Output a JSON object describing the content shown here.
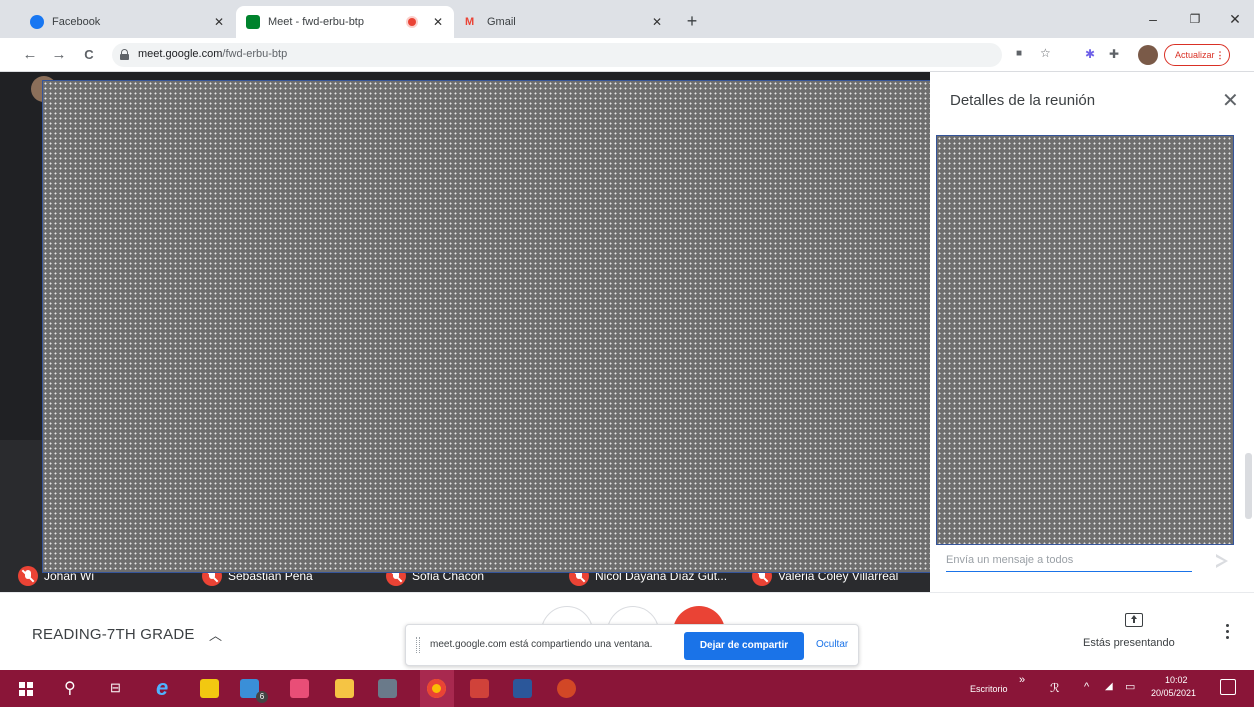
{
  "browser": {
    "tabs": [
      {
        "title": "Facebook",
        "close": "✕",
        "favicon_color": "#1877f2",
        "active": false
      },
      {
        "title": "Meet - fwd-erbu-btp",
        "close": "✕",
        "favicon_color": "#00832d",
        "active": true,
        "recording": true
      },
      {
        "title": "Gmail",
        "close": "✕",
        "favicon_color": "#ea4335",
        "active": false
      }
    ],
    "new_tab": "+",
    "window_controls": {
      "minimize": "–",
      "restore": "❐",
      "close": "✕"
    },
    "nav": {
      "back": "←",
      "forward": "→",
      "reload": "C"
    },
    "url": {
      "domain": "meet.google.com",
      "path": "/fwd-erbu-btp"
    },
    "update_button": "Actualizar",
    "update_menu": "⋮"
  },
  "meet": {
    "participants": [
      {
        "name": "Johan Wi",
        "muted": true
      },
      {
        "name": "Sebastian Peña",
        "muted": true
      },
      {
        "name": "Sofia Chacón",
        "muted": true
      },
      {
        "name": "Nicol Dayana Díaz Gut...",
        "muted": true
      },
      {
        "name": "Valeria Coley Villarreal",
        "muted": true
      }
    ],
    "panel": {
      "title": "Detalles de la reunión",
      "chat_placeholder": "Envía un mensaje a todos"
    },
    "meeting_name": "READING-7TH GRADE",
    "share_bar": {
      "message": "meet.google.com está compartiendo una ventana.",
      "stop_label": "Dejar de compartir",
      "hide_label": "Ocultar"
    },
    "presenting_label": "Estás presentando"
  },
  "taskbar": {
    "desktop_label": "Escritorio",
    "chevron": "»",
    "mail_badge": "6",
    "clock_time": "10:02",
    "clock_date": "20/05/2021"
  },
  "colors": {
    "meet_dark": "#202124",
    "mute_red": "#ea4335",
    "accent_blue": "#1a73e8",
    "taskbar": "#8a1538"
  }
}
